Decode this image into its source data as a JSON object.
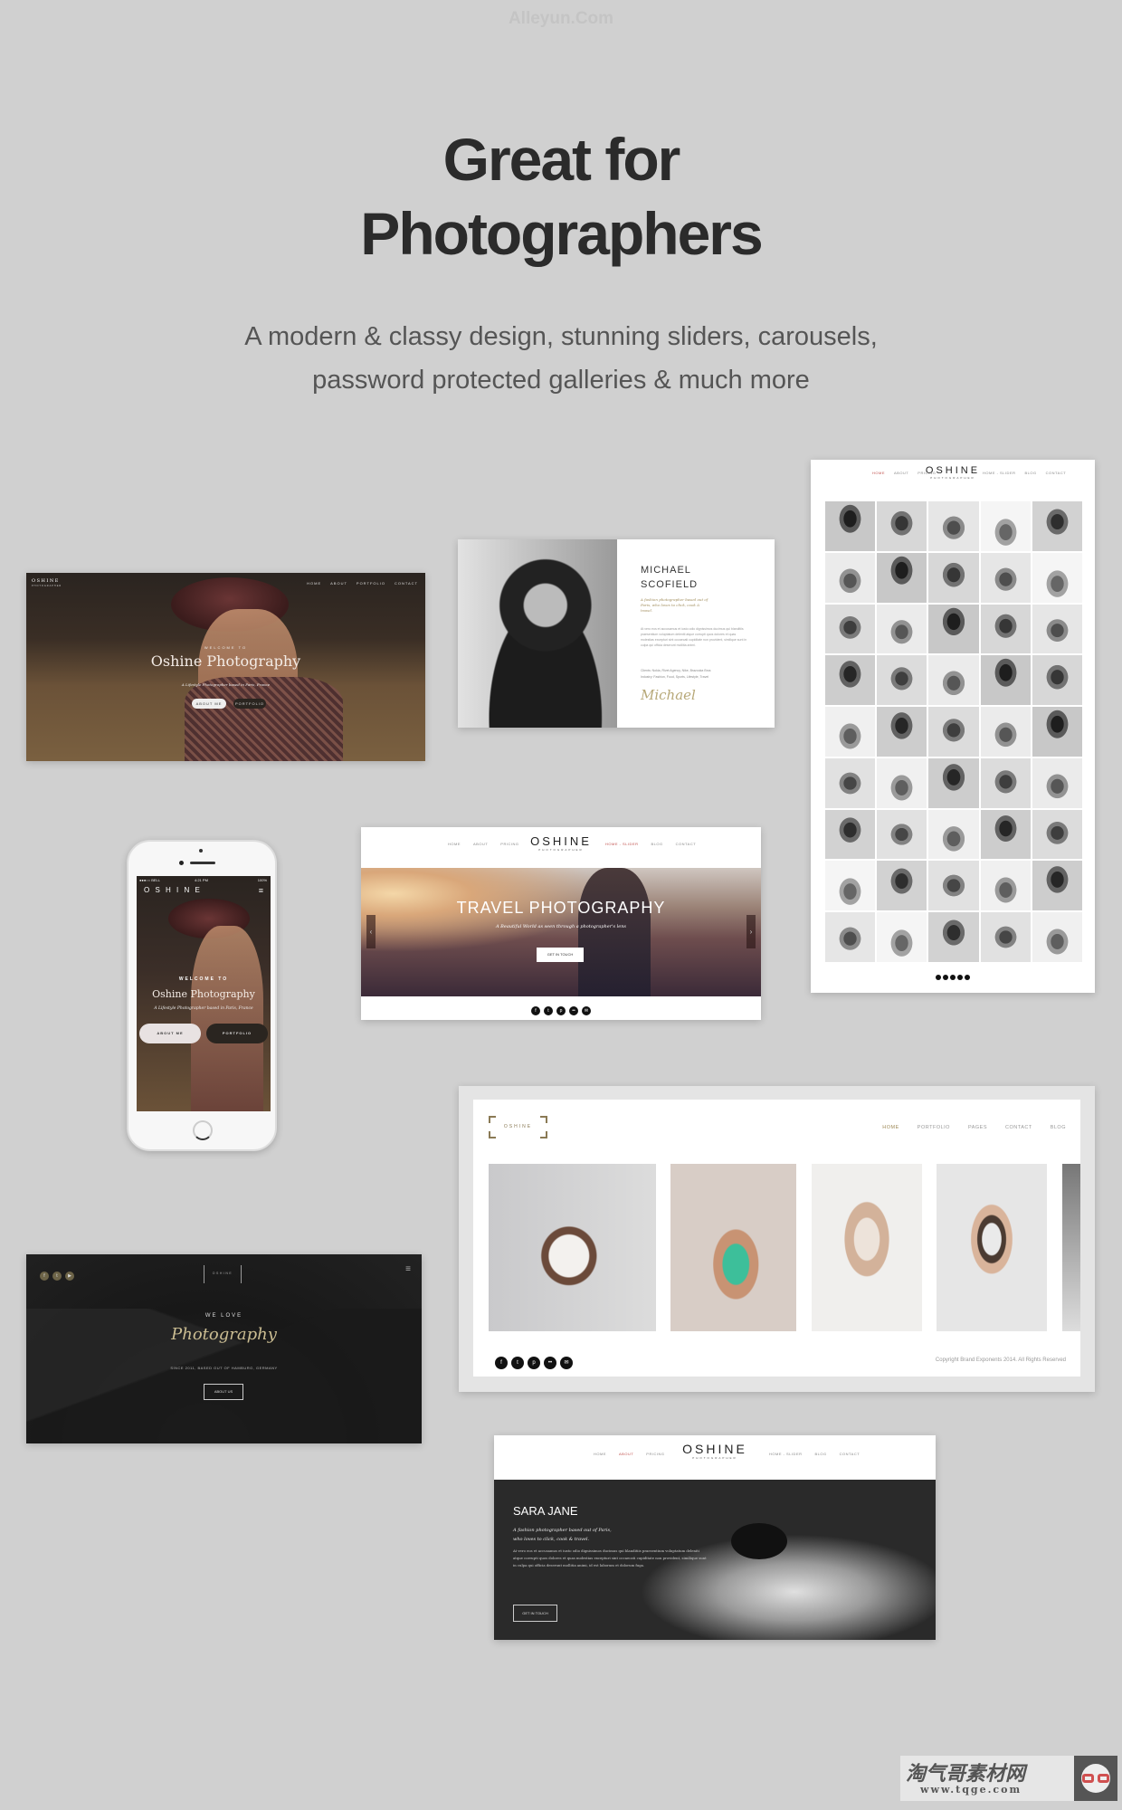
{
  "watermark_top": "Alleyun.Com",
  "headline": {
    "line1": "Great for",
    "line2": "Photographers"
  },
  "subtitle": {
    "line1": "A modern & classy design, stunning sliders, carousels,",
    "line2": "password protected galleries & much more"
  },
  "colors": {
    "background": "#d0d0d0",
    "headline": "#2b2b2b",
    "accent_gold": "#a08c5b",
    "accent_red": "#c0504d"
  },
  "hero_card": {
    "logo": "OSHINE",
    "logo_sub": "PHOTOGRAPHER",
    "nav": [
      "HOME",
      "ABOUT",
      "PORTFOLIO",
      "CONTACT"
    ],
    "welcome": "WELCOME TO",
    "title": "Oshine Photography",
    "tagline": "A Lifestyle Photographer based in Paris, France",
    "buttons": [
      "ABOUT ME",
      "PORTFOLIO"
    ]
  },
  "about_card": {
    "name_line1": "MICHAEL",
    "name_line2": "SCOFIELD",
    "tagline": "A fashion photographer based out of Paris, who loves to click, cook & travel.",
    "body": "At vero eos et accusamus et iusto odio dignissimos ducimus qui blanditiis praesentium voluptatum deleniti atque corrupti quos dolores et quas molestias excepturi sint occaecati cupiditate non provident, similique sunt in culpa qui officia deserunt mollitia animi.",
    "clients": "Clients: Nokia, Rivet Agency, Nike, Brazooka Bros",
    "industry": "Industry: Fashion, Food, Sports, Lifestyle, Travel",
    "signature": "Michael"
  },
  "grid_card": {
    "nav_left": [
      "HOME",
      "ABOUT",
      "PRICING"
    ],
    "nav_right": [
      "HOME - SLIDER",
      "BLOG",
      "CONTACT"
    ],
    "logo": "OSHINE",
    "logo_sub": "PHOTOGRAPHER",
    "pagination_dots": 5
  },
  "phone": {
    "carrier": "●●●○○ BELL",
    "time": "4:21 PM",
    "battery": "100%",
    "logo": "O S H I N E",
    "welcome": "WELCOME TO",
    "title": "Oshine Photography",
    "tagline": "A Lifestyle Photographer based in Paris, France",
    "buttons": [
      "ABOUT ME",
      "PORTFOLIO"
    ]
  },
  "slider_card": {
    "nav_left": [
      "HOME",
      "ABOUT",
      "PRICING"
    ],
    "nav_right": [
      "HOME - SLIDER",
      "BLOG",
      "CONTACT"
    ],
    "logo": "OSHINE",
    "logo_sub": "PHOTOGRAPHER",
    "title": "TRAVEL PHOTOGRAPHY",
    "tagline": "A Beautiful World as seen through a photographer's lens",
    "button": "GET IN TOUCH",
    "prev": "‹",
    "next": "›",
    "social": [
      "f",
      "t",
      "p",
      "••",
      "✉"
    ]
  },
  "portfolio_card": {
    "logo": "OSHINE",
    "nav": [
      "HOME",
      "PORTFOLIO",
      "PAGES",
      "CONTACT",
      "BLOG"
    ],
    "social": [
      "f",
      "t",
      "p",
      "••",
      "✉"
    ],
    "copyright": "Copyright Brand Exponents 2014. All Rights Reserved"
  },
  "dark_card": {
    "social": [
      "f",
      "t",
      "▶"
    ],
    "logo": "OSHINE",
    "kicker": "WE LOVE",
    "title": "Photography",
    "tagline": "SINCE 2011, BASED OUT OF HAMBURG, GERMANY",
    "button": "ABOUT US"
  },
  "sara_card": {
    "nav_left": [
      "HOME",
      "ABOUT",
      "PRICING"
    ],
    "nav_right": [
      "HOME - SLIDER",
      "BLOG",
      "CONTACT"
    ],
    "logo": "OSHINE",
    "logo_sub": "PHOTOGRAPHER",
    "name": "SARA JANE",
    "tagline1": "A fashion photographer based out of Paris,",
    "tagline2": "who loves to click, cook & travel.",
    "body": "At vero eos et accusamus et iusto odio dignissimos ducimus qui blanditiis praesentium voluptatum deleniti atque corrupti quos dolores et quas molestias excepturi sint occaecati cupiditate non provident, similique sunt in culpa qui officia deserunt mollitia animi, id est laborum et dolorum fuga.",
    "button": "GET IN TOUCH"
  },
  "watermark_bottom": {
    "name": "淘气哥素材网",
    "url": "www.tqge.com"
  }
}
